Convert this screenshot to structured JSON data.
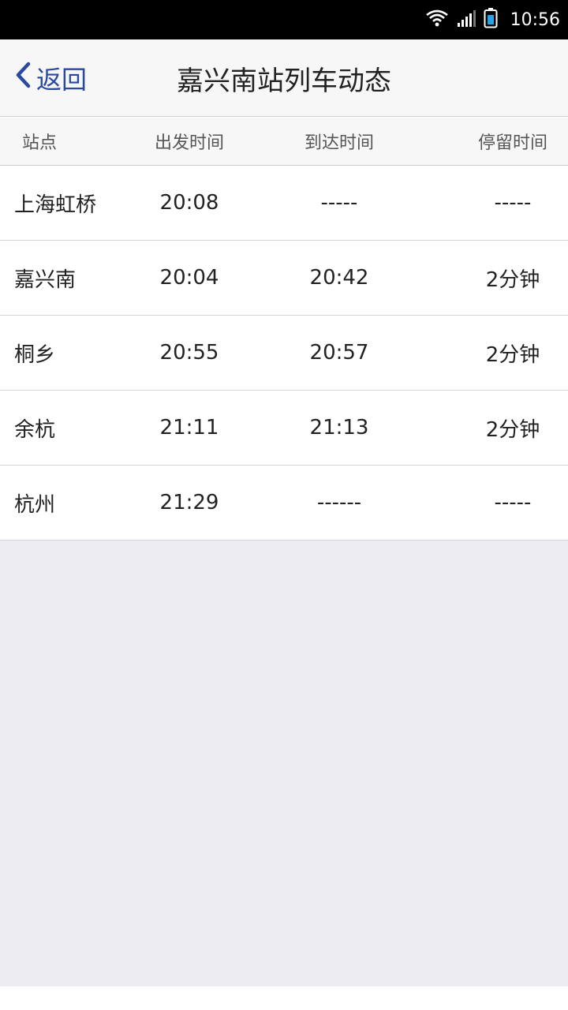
{
  "status_bar": {
    "time": "10:56",
    "icons": [
      "wifi-icon",
      "signal-icon",
      "battery-icon"
    ]
  },
  "nav": {
    "back_label": "返回",
    "title": "嘉兴南站列车动态"
  },
  "table": {
    "headers": [
      "站点",
      "出发时间",
      "到达时间",
      "停留时间"
    ],
    "rows": [
      {
        "station": "上海虹桥",
        "depart": "20:08",
        "arrive": "-----",
        "stay": "-----"
      },
      {
        "station": "嘉兴南",
        "depart": "20:04",
        "arrive": "20:42",
        "stay": "2分钟"
      },
      {
        "station": "桐乡",
        "depart": "20:55",
        "arrive": "20:57",
        "stay": "2分钟"
      },
      {
        "station": "余杭",
        "depart": "21:11",
        "arrive": "21:13",
        "stay": "2分钟"
      },
      {
        "station": "杭州",
        "depart": "21:29",
        "arrive": "------",
        "stay": "-----"
      }
    ]
  },
  "colors": {
    "accent": "#2a4aa0",
    "header_bg": "#f7f7f7",
    "empty_bg": "#ececf2"
  }
}
